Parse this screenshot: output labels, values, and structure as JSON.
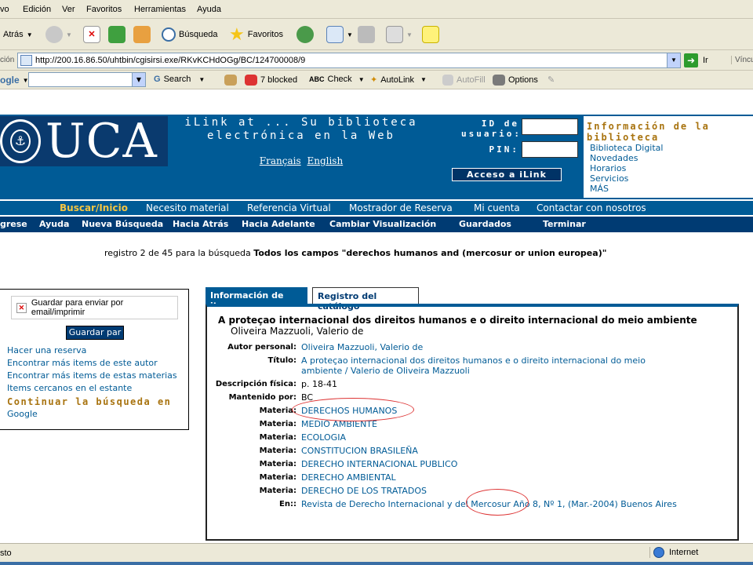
{
  "menu": [
    "vo",
    "Edición",
    "Ver",
    "Favoritos",
    "Herramientas",
    "Ayuda"
  ],
  "toolbar": {
    "back": "Atrás",
    "search": "Búsqueda",
    "favorites": "Favoritos"
  },
  "address": {
    "label": "ción",
    "url": "http://200.16.86.50/uhtbin/cgisirsi.exe/RKvKCHdOGg/BC/124700008/9",
    "go": "Ir",
    "links": "Víncul"
  },
  "googlebar": {
    "brand": "ogle",
    "search": "Search",
    "blocked": "7 blocked",
    "check": "Check",
    "autolink": "AutoLink",
    "autofill": "AutoFill",
    "options": "Options"
  },
  "banner": {
    "logo": "UCA",
    "title": "iLink at ... Su biblioteca electrónica en la Web",
    "lang_fr": "Français",
    "lang_en": "English",
    "id_label": "ID de usuario:",
    "pin_label": "PIN:",
    "access_button": "Acceso a iLink",
    "info_title": "Información de la biblioteca",
    "info_links": [
      "Biblioteca Digital",
      "Novedades",
      "Horarios",
      "Servicios",
      "MÁS"
    ]
  },
  "nav_primary": [
    "Buscar/Inicio",
    "Necesito material",
    "Referencia Virtual",
    "Mostrador de Reserva",
    "Mi cuenta",
    "Contactar con nosotros"
  ],
  "nav_secondary": [
    "gresе",
    "Ayuda",
    "Nueva Búsqueda",
    "Hacia Atrás",
    "Hacia Adelante",
    "Cambiar Visualización",
    "Guardados",
    "Terminar"
  ],
  "search_summary": {
    "prefix": "registro 2 de 45 para la búsqueda",
    "query": "Todos los campos \"derechos humanos and (mercosur or union europea)\""
  },
  "sidebar": {
    "save_label": "Guardar para enviar por email/imprimir",
    "save_button": "Guardar par",
    "links": [
      "Hacer una reserva",
      "Encontrar más items de este autor",
      "Encontrar más items de estas materias",
      "Items cercanos en el estante"
    ],
    "continue": "Continuar la búsqueda en",
    "google": "Google"
  },
  "tabs": {
    "item_info": "Información de item",
    "catalog": "Registro del catálogo"
  },
  "record": {
    "title": "A proteçao internacional dos direitos humanos e o direito internacional do meio ambiente",
    "author_line": "Oliveira Mazzuoli, Valerio de",
    "fields": [
      {
        "label": "Autor personal:",
        "value": "Oliveira Mazzuoli, Valerio de"
      },
      {
        "label": "Título:",
        "value": "A proteçao internacional dos direitos humanos e o direito internacional do meio ambiente / Valerio de Oliveira Mazzuoli"
      },
      {
        "label": "Descripción física:",
        "value": "p. 18-41"
      },
      {
        "label": "Mantenido por:",
        "value": "BC"
      },
      {
        "label": "Materia:",
        "value": "DERECHOS HUMANOS"
      },
      {
        "label": "Materia:",
        "value": "MEDIO AMBIENTE"
      },
      {
        "label": "Materia:",
        "value": "ECOLOGIA"
      },
      {
        "label": "Materia:",
        "value": "CONSTITUCION BRASILEÑA"
      },
      {
        "label": "Materia:",
        "value": "DERECHO INTERNACIONAL PUBLICO"
      },
      {
        "label": "Materia:",
        "value": "DERECHO AMBIENTAL"
      },
      {
        "label": "Materia:",
        "value": "DERECHO DE LOS TRATADOS"
      },
      {
        "label": "En::",
        "value": "Revista de Derecho Internacional y del Mercosur Año 8, Nº 1, (Mar.-2004) Buenos Aires"
      }
    ]
  },
  "status": {
    "left": "sto",
    "zone": "Internet"
  },
  "colors": {
    "brand_blue": "#005b96",
    "dark_blue": "#003b73",
    "gold": "#a8730f",
    "highlight": "#d33333"
  }
}
